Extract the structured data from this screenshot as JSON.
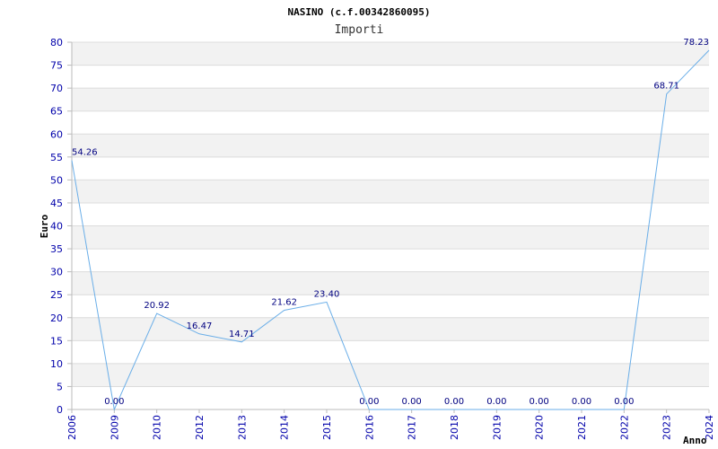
{
  "chart_data": {
    "type": "line",
    "title": "NASINO (c.f.00342860095)",
    "subtitle": "Importi",
    "xlabel": "Anno",
    "ylabel": "Euro",
    "categories": [
      "2006",
      "2009",
      "2010",
      "2012",
      "2013",
      "2014",
      "2015",
      "2016",
      "2017",
      "2018",
      "2019",
      "2020",
      "2021",
      "2022",
      "2023",
      "2024"
    ],
    "values": [
      54.26,
      0.0,
      20.92,
      16.47,
      14.71,
      21.62,
      23.4,
      0.0,
      0.0,
      0.0,
      0.0,
      0.0,
      0.0,
      0.0,
      68.71,
      78.23
    ],
    "value_labels": [
      "54.26",
      "0.00",
      "20.92",
      "16.47",
      "14.71",
      "21.62",
      "23.40",
      "0.00",
      "0.00",
      "0.00",
      "0.00",
      "0.00",
      "0.00",
      "0.00",
      "68.71",
      "78.23"
    ],
    "y_ticks": [
      "0",
      "5",
      "10",
      "15",
      "20",
      "25",
      "30",
      "35",
      "40",
      "45",
      "50",
      "55",
      "60",
      "65",
      "70",
      "75",
      "80"
    ],
    "ylim": [
      0,
      80
    ],
    "grid": true,
    "colors": {
      "line": "#6aaee8",
      "band": "#f2f2f2",
      "gridline": "#dcdcdc",
      "axis": "#bbbbbb",
      "tick_text": "#0000aa",
      "data_label": "#000080"
    }
  }
}
